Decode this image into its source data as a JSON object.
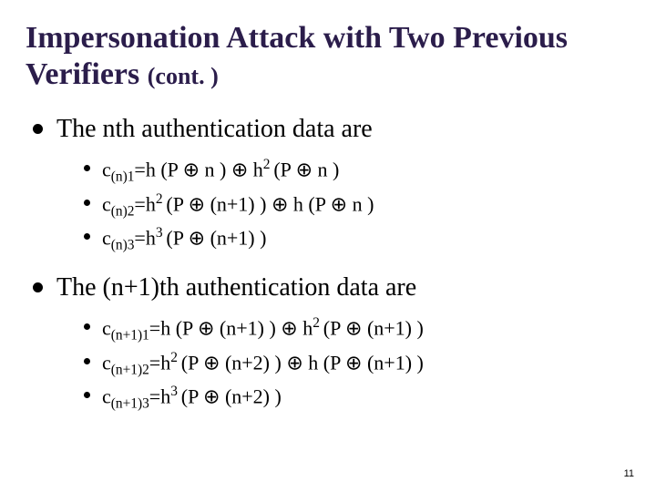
{
  "title_main": "Impersonation Attack with Two Previous Verifiers",
  "title_cont": "(cont. )",
  "section1": {
    "heading": "The nth authentication data are",
    "items": [
      "c<span class=\"sub\">(n)1</span>=h  (P <span class=\"oplus\">⊕</span> n ) <span class=\"oplus\">⊕</span> h<span class=\"sup\">2 </span>(P <span class=\"oplus\">⊕</span> n )",
      "c<span class=\"sub\">(n)2</span>=h<span class=\"sup\">2 </span>(P <span class=\"oplus\">⊕</span> (n+1) ) <span class=\"oplus\">⊕</span> h (P <span class=\"oplus\">⊕</span> n )",
      "c<span class=\"sub\">(n)3</span>=h<span class=\"sup\">3 </span>(P <span class=\"oplus\">⊕</span> (n+1) )"
    ]
  },
  "section2": {
    "heading": "The (n+1)th authentication data are",
    "items": [
      "c<span class=\"sub\">(n+1)1</span>=h  (P <span class=\"oplus\">⊕</span> (n+1) ) <span class=\"oplus\">⊕</span> h<span class=\"sup\">2 </span>(P <span class=\"oplus\">⊕</span> (n+1) )",
      "c<span class=\"sub\">(n+1)2</span>=h<span class=\"sup\">2 </span>(P <span class=\"oplus\">⊕</span> (n+2) ) <span class=\"oplus\">⊕</span> h (P <span class=\"oplus\">⊕</span> (n+1) )",
      "c<span class=\"sub\">(n+1)3</span>=h<span class=\"sup\">3 </span>(P <span class=\"oplus\">⊕</span> (n+2) )"
    ]
  },
  "page_number": "11"
}
